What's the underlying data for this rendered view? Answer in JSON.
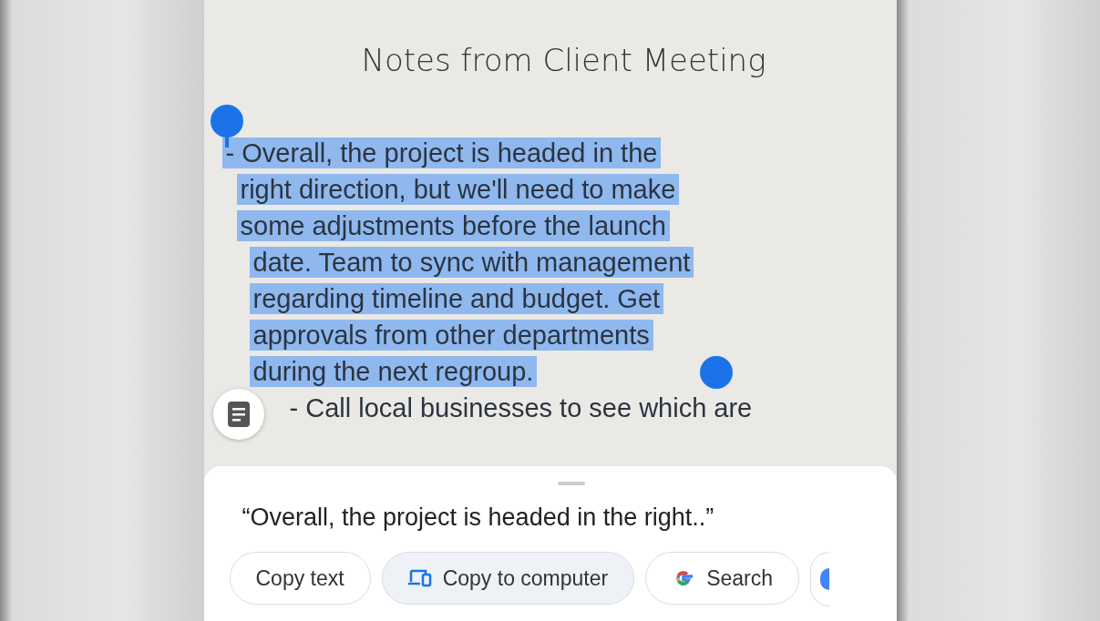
{
  "note": {
    "title": "Notes from Client Meeting",
    "lines": [
      {
        "text": "- Overall, the project is headed in the",
        "highlighted": true
      },
      {
        "text": "right direction, but we'll need to make",
        "highlighted": true
      },
      {
        "text": "some adjustments before the launch",
        "highlighted": true
      },
      {
        "text": "date. Team to sync with management",
        "highlighted": true
      },
      {
        "text": "regarding timeline and budget. Get",
        "highlighted": true
      },
      {
        "text": "approvals from other departments",
        "highlighted": true
      },
      {
        "text": "during the next regroup.",
        "highlighted": true
      },
      {
        "text": "- Call local businesses to see which are",
        "highlighted": false
      }
    ]
  },
  "sheet": {
    "quote": "“Overall, the project is headed in the right..”",
    "chips": [
      {
        "kind": "text",
        "label": "Copy text",
        "selected": false
      },
      {
        "kind": "computer",
        "label": "Copy to computer",
        "selected": true
      },
      {
        "kind": "google",
        "label": "Search",
        "selected": false
      }
    ]
  }
}
